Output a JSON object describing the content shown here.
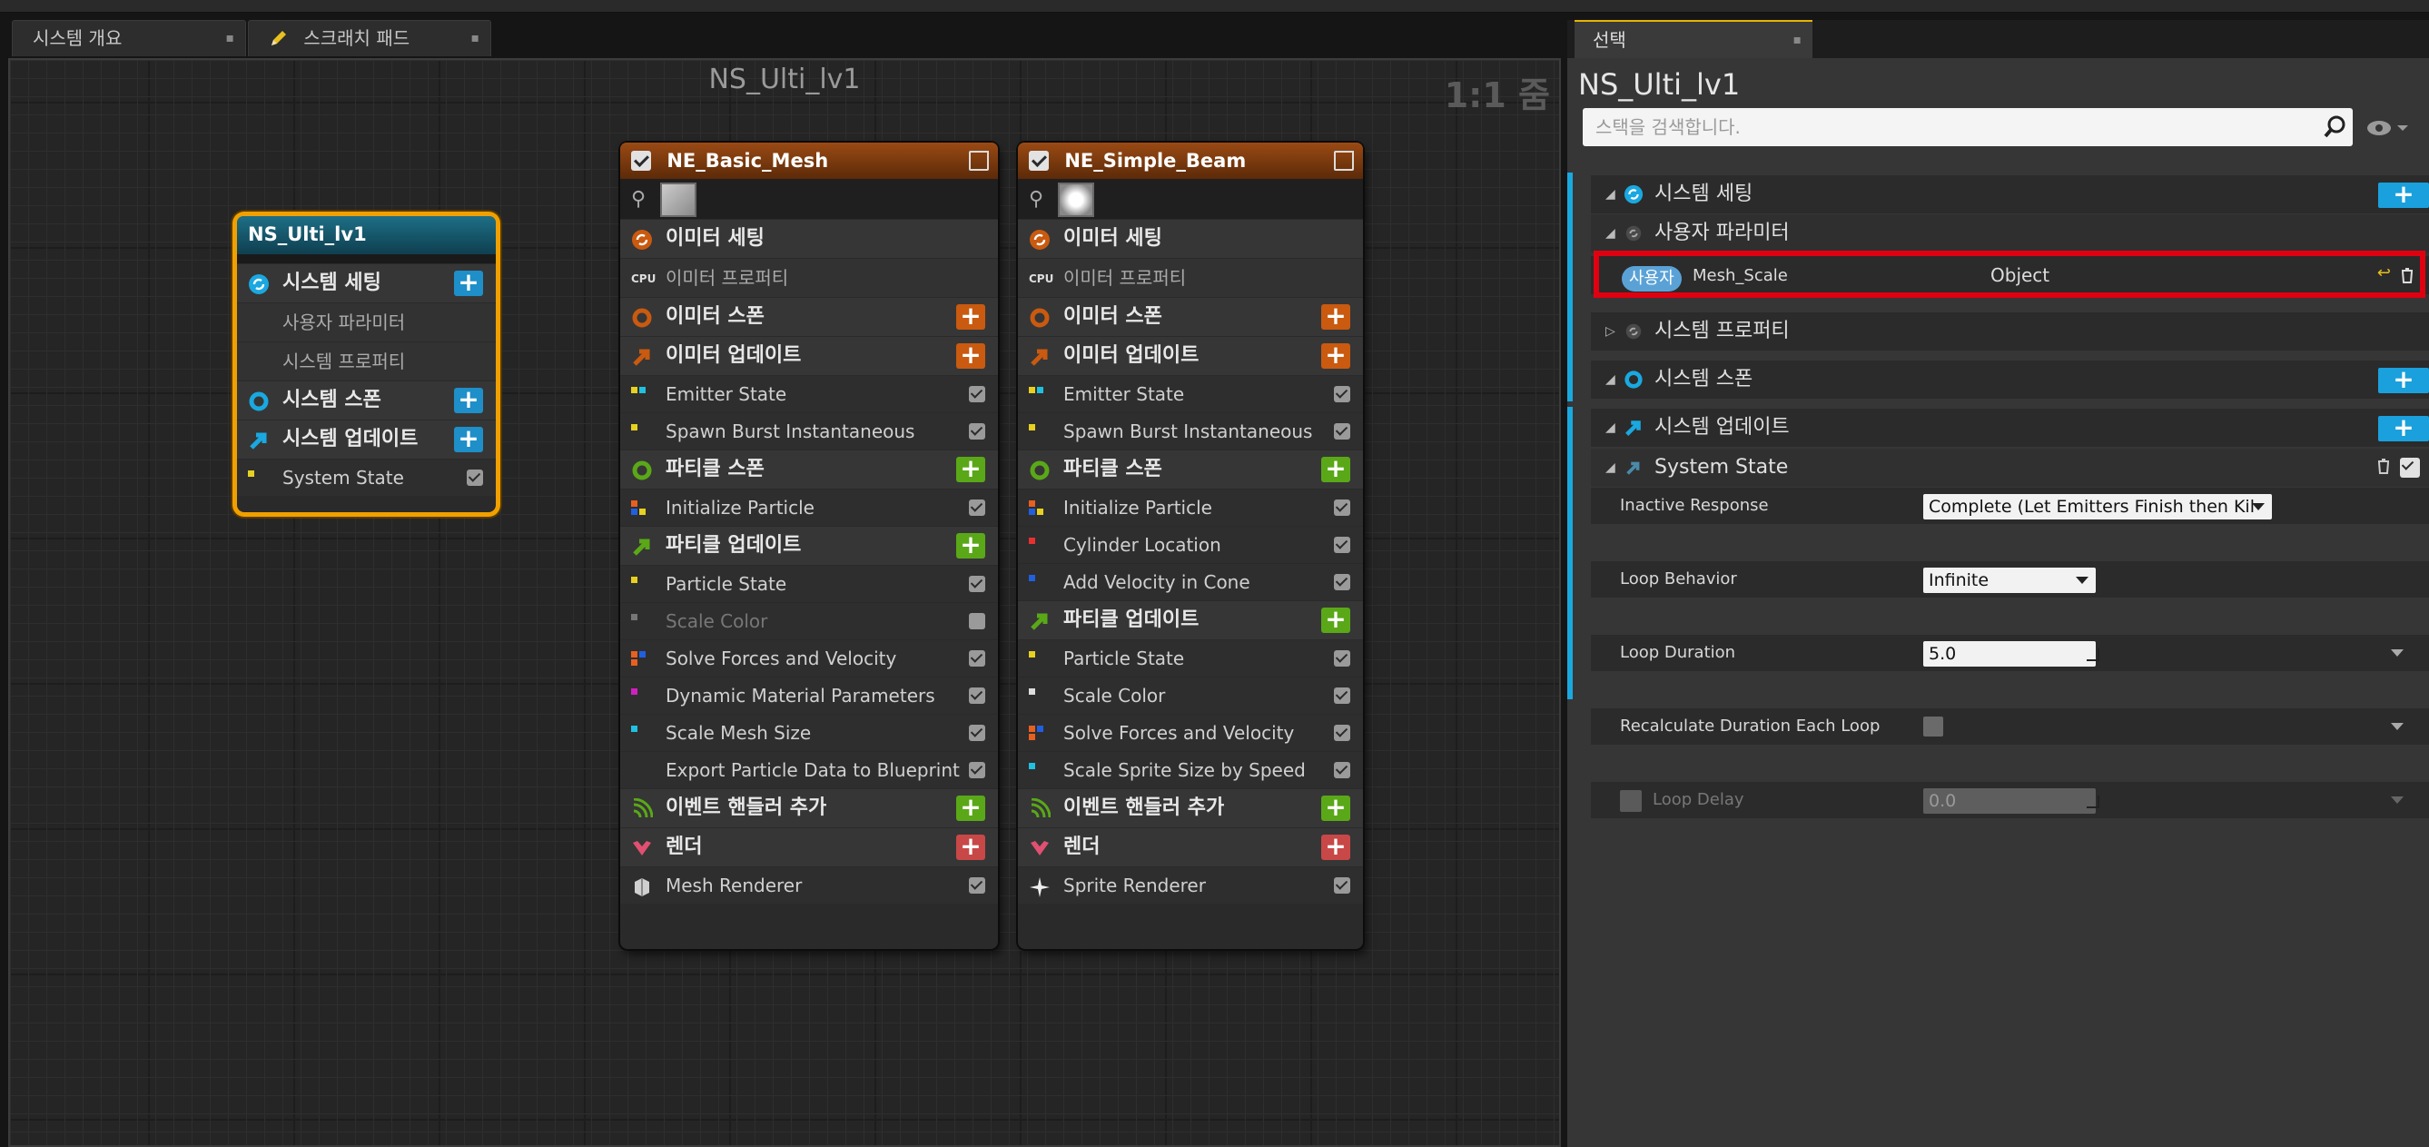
{
  "tabs": [
    {
      "label": "시스템 개요",
      "close": "▪"
    },
    {
      "label": "스크래치 패드",
      "close": "▪"
    }
  ],
  "graph": {
    "title": "NS_Ulti_lv1",
    "zoom": "1:1 줌"
  },
  "system_node": {
    "title": "NS_Ulti_lv1",
    "rows": {
      "settings": "시스템 세팅",
      "user_params": "사용자 파라미터",
      "sys_props": "시스템 프로퍼티",
      "spawn": "시스템 스폰",
      "update": "시스템 업데이트",
      "state": "System State"
    },
    "plus": "+"
  },
  "emitter1": {
    "title": "NE_Basic_Mesh",
    "emitter_settings": "이미터 세팅",
    "emitter_props": "이미터 프로퍼티",
    "emitter_spawn": "이미터 스폰",
    "emitter_update": "이미터 업데이트",
    "emitter_state": "Emitter State",
    "spawn_burst": "Spawn Burst Instantaneous",
    "particle_spawn": "파티클 스폰",
    "init_particle": "Initialize Particle",
    "particle_update": "파티클 업데이트",
    "particle_state": "Particle State",
    "scale_color": "Scale Color",
    "solve_forces": "Solve Forces and Velocity",
    "dyn_mat": "Dynamic Material Parameters",
    "scale_mesh": "Scale Mesh Size",
    "export": "Export Particle Data to Blueprint",
    "event_handler": "이벤트 핸들러 추가",
    "render": "렌더",
    "renderer": "Mesh Renderer"
  },
  "emitter2": {
    "title": "NE_Simple_Beam",
    "emitter_settings": "이미터 세팅",
    "emitter_props": "이미터 프로퍼티",
    "emitter_spawn": "이미터 스폰",
    "emitter_update": "이미터 업데이트",
    "emitter_state": "Emitter State",
    "spawn_burst": "Spawn Burst Instantaneous",
    "particle_spawn": "파티클 스폰",
    "init_particle": "Initialize Particle",
    "cylinder": "Cylinder Location",
    "add_velocity": "Add Velocity in Cone",
    "particle_update": "파티클 업데이트",
    "particle_state": "Particle State",
    "scale_color": "Scale Color",
    "solve_forces": "Solve Forces and Velocity",
    "scale_sprite": "Scale Sprite Size by Speed",
    "event_handler": "이벤트 핸들러 추가",
    "render": "렌더",
    "renderer": "Sprite Renderer"
  },
  "cpu_label": "CPU",
  "panel": {
    "tab": "선택",
    "title": "NS_Ulti_lv1",
    "search_placeholder": "스택을 검색합니다.",
    "sections": {
      "settings": "시스템 세팅",
      "user_params": "사용자 파라미터",
      "sys_props": "시스템 프로퍼티",
      "spawn": "시스템 스폰",
      "update": "시스템 업데이트",
      "state": "System State"
    },
    "user_param": {
      "chip": "사용자",
      "name": "Mesh_Scale",
      "type": "Object"
    },
    "props": [
      {
        "label": "Inactive Response",
        "value": "Complete (Let Emitters Finish then Kil"
      },
      {
        "label": "Loop Behavior",
        "value": "Infinite"
      },
      {
        "label": "Loop Duration",
        "value": "5.0"
      },
      {
        "label": "Recalculate Duration Each Loop",
        "value": ""
      },
      {
        "label": "Loop Delay",
        "value": "0.0"
      }
    ]
  },
  "colors": {
    "selection_orange": "#f0a000",
    "accent_blue": "#1aa8e0",
    "highlight_red": "#e00010",
    "emitter_orange": "#c95a10",
    "particle_green": "#5aa818",
    "render_red": "#c84848"
  }
}
